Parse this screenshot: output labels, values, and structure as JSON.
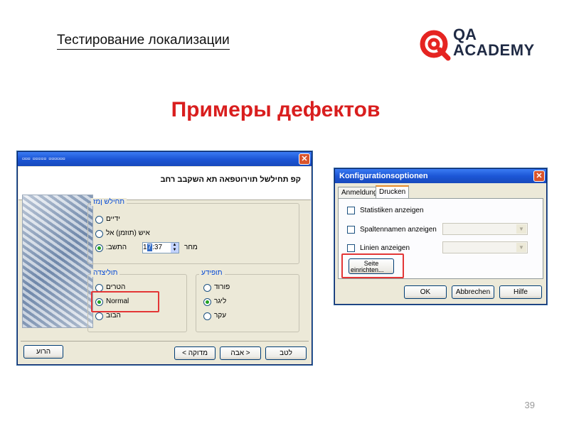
{
  "slide": {
    "header_title": "Тестирование локализации",
    "heading": "Примеры дефектов",
    "page_number": "39"
  },
  "logo": {
    "qa": "QA",
    "academy": "ACADEMY",
    "icon": "qa-academy-logo-icon",
    "color": "#e52421"
  },
  "hebrew_dialog": {
    "title": "▫▫▫ ▫▫▫▫▫ ▫▫▫▫▫▫",
    "header_text": "קפ תחילשל תוירוטפאה תא השקבב רחב",
    "group_when": {
      "label": "תחילש ןמז",
      "options": [
        "ידיים",
        "איש (תוזמן) אל",
        "התשב:"
      ],
      "time_prefix": "1",
      "time_selected": "7",
      "time_rest": ":37",
      "time_suffix": "מחר"
    },
    "group_priority": {
      "label": "תוליצדה",
      "options": [
        "הטרים",
        "Normal",
        "הבוב"
      ]
    },
    "group_format": {
      "label": "תופידע",
      "options": [
        "פורוד",
        "ליגר",
        "עקר"
      ]
    },
    "buttons": {
      "help": "הרוע",
      "back": "< מדוקה",
      "next": "אבה >",
      "cancel": "לטב"
    },
    "close_symbol": "✕"
  },
  "german_dialog": {
    "title": "Konfigurationsoptionen",
    "tabs": [
      "Anmeldung",
      "Drucken"
    ],
    "active_tab": "Drucken",
    "checkboxes": [
      "Statistiken anzeigen",
      "Spaltennamen anzeigen",
      "Linien anzeigen"
    ],
    "page_setup_line1": "Seite",
    "page_setup_line2": "einrichten...",
    "buttons": {
      "ok": "OK",
      "cancel": "Abbrechen",
      "help": "Hilfe"
    },
    "close_symbol": "✕"
  },
  "colors": {
    "heading": "#d91e1e",
    "highlight": "#e33636",
    "xp_title": "#1c56d6"
  }
}
